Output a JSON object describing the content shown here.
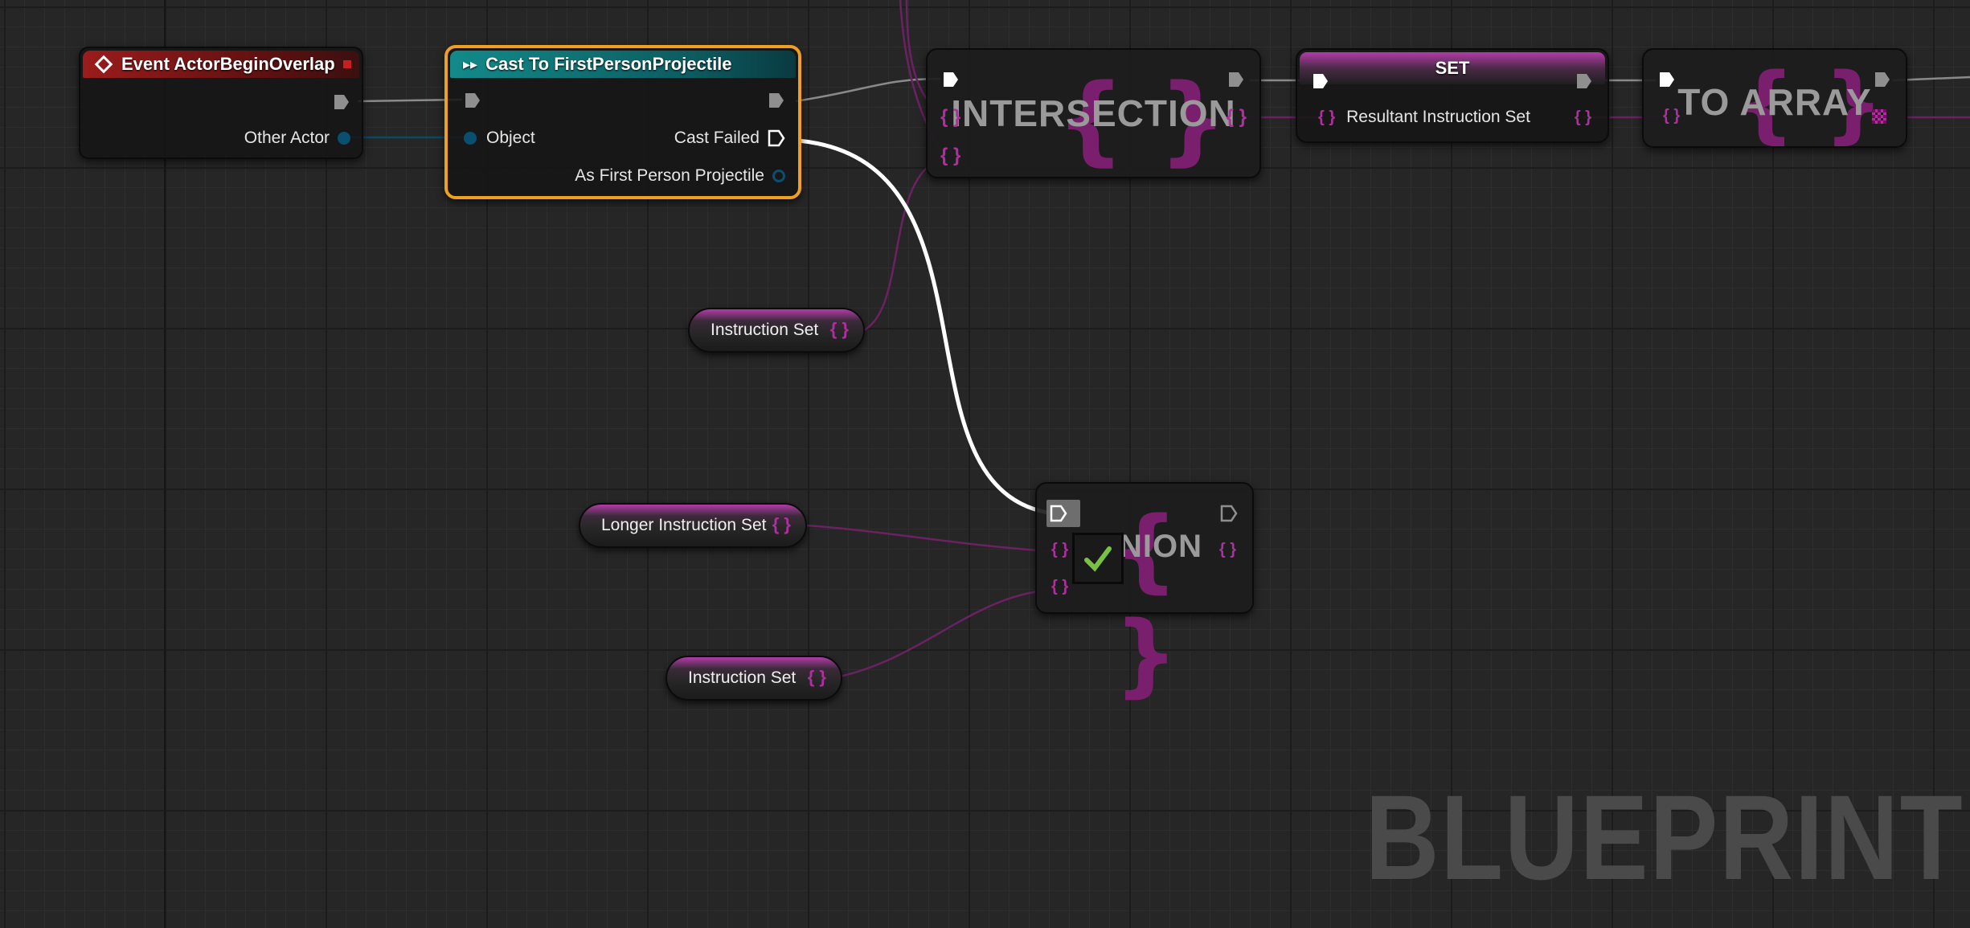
{
  "graph": {
    "watermark": "BLUEPRINT",
    "colors": {
      "event_header": "#8c1a1a",
      "cast_header": "#137a7a",
      "selection_border": "#f0a020",
      "set_pin": "#b02fa0",
      "object_pin": "#0a5a7a",
      "exec_wire": "#ffffff"
    },
    "nodes": {
      "event_begin_overlap": {
        "title": "Event ActorBeginOverlap",
        "icon": "event-diamond-icon",
        "pins": {
          "other_actor": "Other Actor"
        }
      },
      "cast_node": {
        "title": "Cast To FirstPersonProjectile",
        "icon": "cast-arrows-icon",
        "selected": true,
        "pins": {
          "object": "Object",
          "cast_failed": "Cast Failed",
          "as_projectile": "As First Person Projectile"
        }
      },
      "intersection_node": {
        "title": "INTERSECTION"
      },
      "set_node": {
        "title": "SET",
        "pins": {
          "resultant": "Resultant Instruction Set"
        }
      },
      "to_array_node": {
        "title": "TO ARRAY"
      },
      "union_node": {
        "title": "NION"
      }
    },
    "variables": {
      "instruction_set_top": "Instruction Set",
      "longer_instruction_set": "Longer Instruction Set",
      "instruction_set_bottom": "Instruction Set"
    }
  }
}
